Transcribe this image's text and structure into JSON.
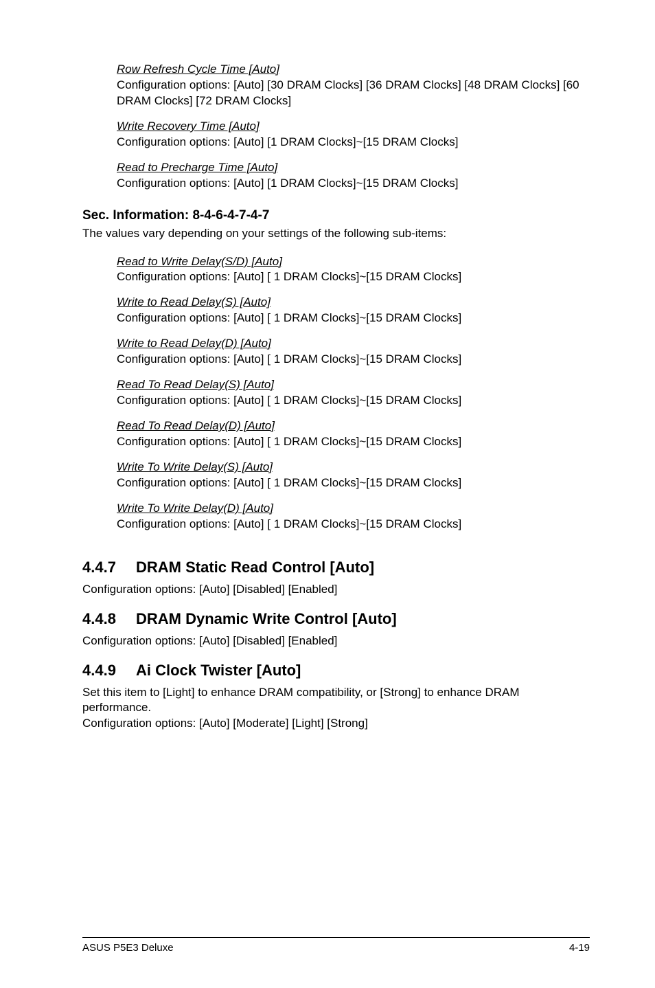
{
  "topItems": [
    {
      "title": "Row Refresh Cycle Time [Auto]",
      "desc": "Configuration options: [Auto] [30 DRAM Clocks] [36 DRAM Clocks] [48 DRAM Clocks] [60 DRAM Clocks] [72 DRAM Clocks]"
    },
    {
      "title": "Write Recovery Time [Auto]",
      "desc": "Configuration options: [Auto] [1 DRAM Clocks]~[15 DRAM Clocks]"
    },
    {
      "title": "Read to Precharge Time [Auto]",
      "desc": "Configuration options: [Auto] [1 DRAM Clocks]~[15 DRAM Clocks]"
    }
  ],
  "secInfo": {
    "heading": "Sec. Information: 8-4-6-4-7-4-7",
    "desc": "The values vary depending on your settings of the following sub-items:"
  },
  "secItems": [
    {
      "title": "Read to Write Delay(S/D) [Auto]",
      "desc": "Configuration options: [Auto] [ 1 DRAM Clocks]~[15 DRAM Clocks]"
    },
    {
      "title": "Write to Read Delay(S) [Auto]",
      "desc": "Configuration options: [Auto] [ 1 DRAM Clocks]~[15 DRAM Clocks]"
    },
    {
      "title": "Write to Read Delay(D) [Auto]",
      "desc": "Configuration options: [Auto] [ 1 DRAM Clocks]~[15 DRAM Clocks]"
    },
    {
      "title": "Read To Read Delay(S) [Auto]",
      "desc": "Configuration options: [Auto] [ 1 DRAM Clocks]~[15 DRAM Clocks]"
    },
    {
      "title": "Read To Read Delay(D) [Auto]",
      "desc": "Configuration options: [Auto] [ 1 DRAM Clocks]~[15 DRAM Clocks]"
    },
    {
      "title": "Write To Write Delay(S) [Auto]",
      "desc": "Configuration options: [Auto] [ 1 DRAM Clocks]~[15 DRAM Clocks]"
    },
    {
      "title": "Write To Write Delay(D) [Auto]",
      "desc": "Configuration options: [Auto] [ 1 DRAM Clocks]~[15 DRAM Clocks]"
    }
  ],
  "sections": [
    {
      "num": "4.4.7",
      "title": "DRAM Static Read Control [Auto]",
      "desc": "Configuration options: [Auto] [Disabled] [Enabled]"
    },
    {
      "num": "4.4.8",
      "title": "DRAM Dynamic Write Control [Auto]",
      "desc": "Configuration options: [Auto] [Disabled] [Enabled]"
    },
    {
      "num": "4.4.9",
      "title": "Ai Clock Twister [Auto]",
      "desc": "Set this item to [Light] to enhance DRAM compatibility, or [Strong] to enhance DRAM performance.\nConfiguration options: [Auto] [Moderate] [Light] [Strong]"
    }
  ],
  "footer": {
    "left": "ASUS P5E3 Deluxe",
    "right": "4-19"
  }
}
